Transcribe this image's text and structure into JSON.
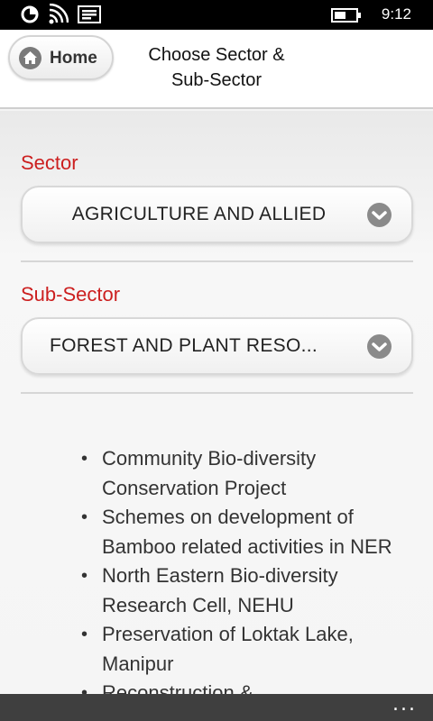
{
  "status_bar": {
    "time": "9:12",
    "icons": [
      "data-sense-icon",
      "wifi-icon",
      "message-icon",
      "battery-icon"
    ]
  },
  "header": {
    "home_label": "Home",
    "title_line1": "Choose Sector &",
    "title_line2": "Sub-Sector"
  },
  "sector": {
    "label": "Sector",
    "selected": "AGRICULTURE AND ALLIED"
  },
  "sub_sector": {
    "label": "Sub-Sector",
    "selected": "FOREST AND PLANT RESO..."
  },
  "schemes": [
    "Community Bio-diversity Conservation Project",
    "Schemes on development of Bamboo related activities in NER",
    "North Eastern Bio-diversity Research Cell, NEHU",
    "Preservation of Loktak Lake, Manipur",
    "Reconstruction &"
  ],
  "app_bar": {
    "more_label": "..."
  },
  "colors": {
    "accent_red": "#cc1f1f",
    "status_bar": "#000000",
    "app_bar": "#3f3f3f"
  }
}
